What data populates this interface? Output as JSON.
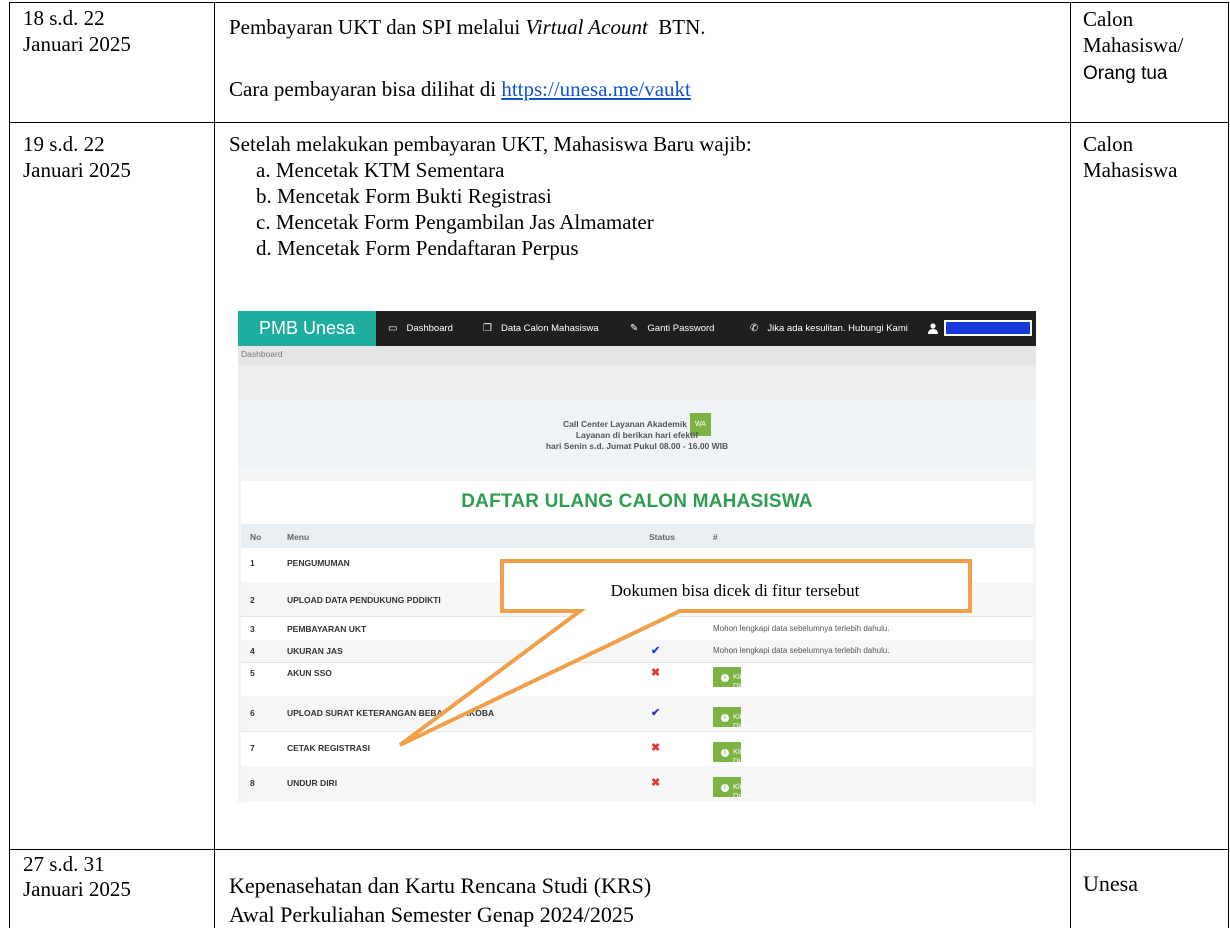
{
  "rows": [
    {
      "date_line1": "18 s.d. 22",
      "date_line2": "Januari 2025",
      "activity_prefix": "Pembayaran UKT dan SPI melalui ",
      "activity_italic": "Virtual Acount",
      "activity_suffix": "  BTN.",
      "how_text": "Cara pembayaran bisa dilihat di ",
      "how_link": "https://unesa.me/vaukt",
      "party_line1": "Calon",
      "party_line2": "Mahasiswa/",
      "party_line3": "Orang tua"
    },
    {
      "date_line1": "19 s.d. 22",
      "date_line2": "Januari 2025",
      "intro": "Setelah melakukan pembayaran UKT, Mahasiswa Baru wajib:",
      "steps": [
        "a. Mencetak KTM Sementara",
        "b. Mencetak Form Bukti Registrasi",
        "c. Mencetak Form Pengambilan Jas Almamater",
        "d. Mencetak Form Pendaftaran Perpus"
      ],
      "party_line1": "Calon",
      "party_line2": "Mahasiswa"
    },
    {
      "date_line1": "27 s.d. 31",
      "date_line2": "Januari 2025",
      "line1": "Kepenasehatan dan Kartu Rencana Studi (KRS)",
      "line2": "Awal Perkuliahan Semester Genap 2024/2025",
      "party": "Unesa"
    }
  ],
  "screenshot": {
    "brand": "PMB Unesa",
    "nav": [
      "Dashboard",
      "Data Calon Mahasiswa",
      "Ganti Password",
      "Jika ada kesulitan. Hubungi Kami"
    ],
    "breadcrumb": "Dashboard",
    "info_line1": "Call Center Layanan Akademik",
    "wa": "WA",
    "info_line2": "Layanan di berikan hari efektif",
    "info_line3": "hari Senin s.d. Jumat Pukul 08.00 - 16.00 WIB",
    "panel_title": "DAFTAR ULANG CALON MAHASISWA",
    "headers": {
      "no": "No",
      "menu": "Menu",
      "status": "Status",
      "hash": "#"
    },
    "items": [
      {
        "no": "1",
        "menu": "PENGUMUMAN"
      },
      {
        "no": "2",
        "menu": "UPLOAD DATA PENDUKUNG PDDIKTI"
      },
      {
        "no": "3",
        "menu": "PEMBAYARAN UKT",
        "note": "Mohon lengkapi data sebelumnya terlebih dahulu."
      },
      {
        "no": "4",
        "menu": "UKURAN JAS",
        "status": "✔",
        "note": "Mohon lengkapi data sebelumnya terlebih dahulu."
      },
      {
        "no": "5",
        "menu": "AKUN SSO",
        "status": "✖",
        "action": "Klik Disini"
      },
      {
        "no": "6",
        "menu": "UPLOAD SURAT KETERANGAN BEBAS NARKOBA",
        "status": "✔",
        "action": "Klik Disini"
      },
      {
        "no": "7",
        "menu": "CETAK REGISTRASI",
        "status": "✖",
        "action": "Klik Disini"
      },
      {
        "no": "8",
        "menu": "UNDUR DIRI",
        "status": "✖",
        "action": "Klik Disini"
      }
    ],
    "info_icon": "i"
  },
  "callout": "Dokumen bisa dicek di fitur tersebut",
  "colors": {
    "accent_green": "#7cb342",
    "brand_teal": "#1fae9d",
    "title_green": "#2e9d4f",
    "link_blue": "#1155cc",
    "callout_orange": "#f0a04b"
  },
  "icons": [
    "monitor-icon",
    "copy-icon",
    "pencil-icon",
    "phone-icon",
    "user-icon",
    "check-icon",
    "cross-icon",
    "info-icon"
  ]
}
